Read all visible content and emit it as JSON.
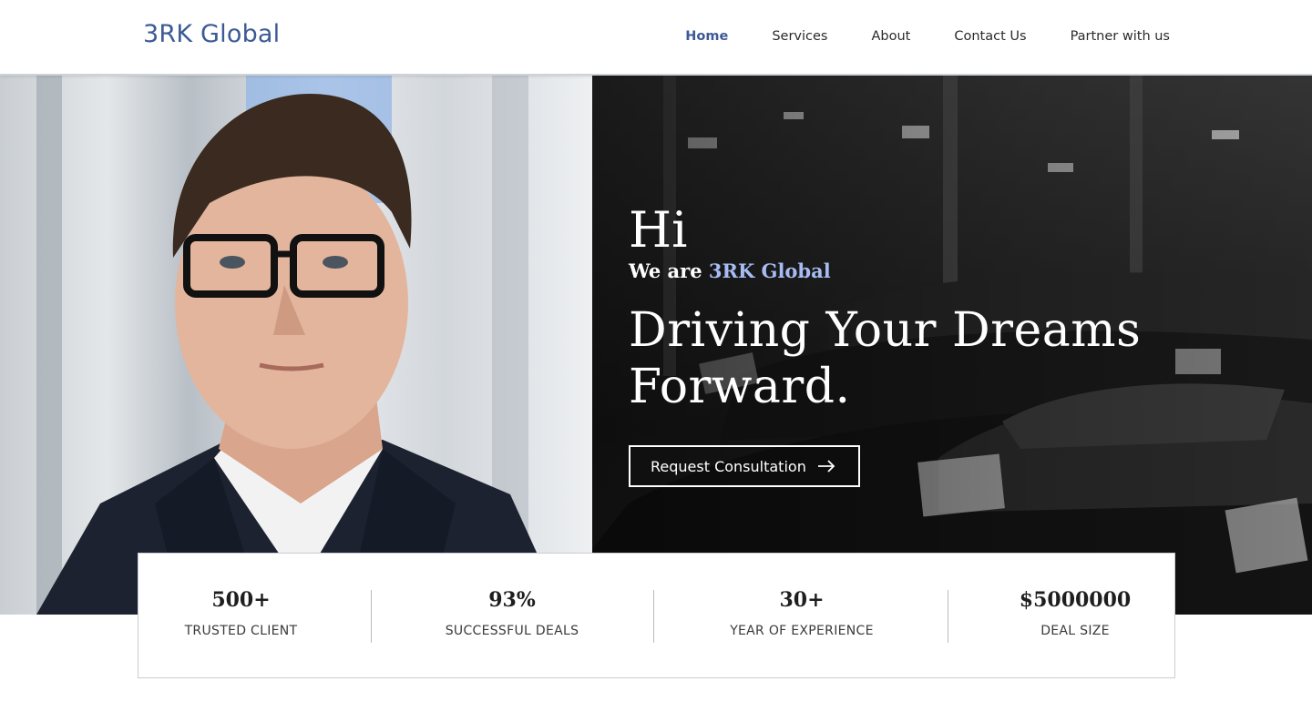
{
  "header": {
    "logo": "3RK Global",
    "nav": [
      {
        "label": "Home",
        "active": true
      },
      {
        "label": "Services"
      },
      {
        "label": "About"
      },
      {
        "label": "Contact Us"
      },
      {
        "label": "Partner with us"
      }
    ]
  },
  "hero": {
    "greeting": "Hi",
    "intro_prefix": "We are ",
    "intro_brand": "3RK Global",
    "headline_line1": "Driving Your Dreams",
    "headline_line2": "Forward.",
    "cta_label": "Request Consultation",
    "cta_icon": "arrow-right-icon"
  },
  "stats": [
    {
      "value": "500+",
      "label": "TRUSTED CLIENT"
    },
    {
      "value": "93%",
      "label": "SUCCESSFUL DEALS"
    },
    {
      "value": "30+",
      "label": "YEAR OF EXPERIENCE"
    },
    {
      "value": "$5000000",
      "label": "DEAL SIZE"
    }
  ],
  "colors": {
    "brand": "#3d5a96",
    "brand_light": "#a6bcf2",
    "text_dark": "#1e1e1e"
  }
}
